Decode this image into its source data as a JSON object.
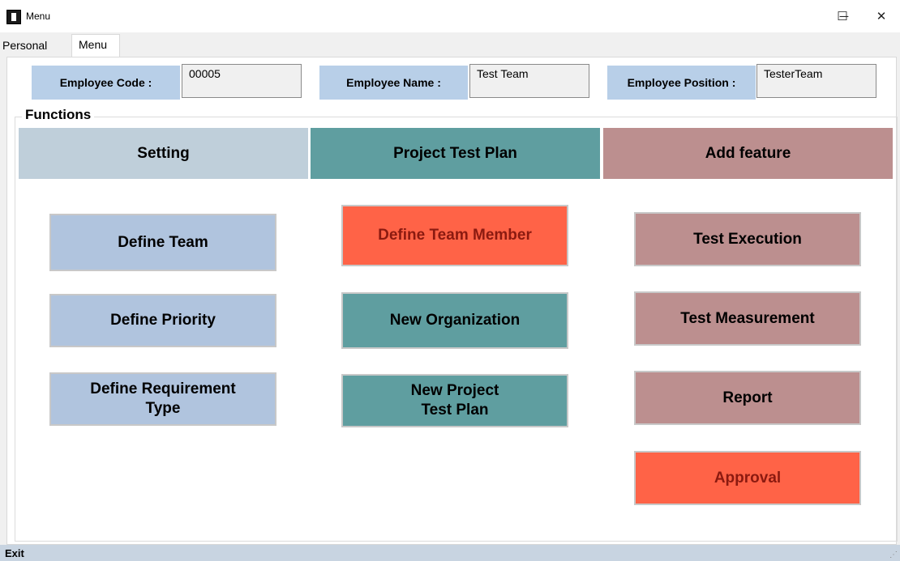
{
  "window": {
    "title": "Menu",
    "minimize": "─",
    "maximize": "☐",
    "close": "✕"
  },
  "tabs": [
    "Personal",
    "Menu"
  ],
  "employee": {
    "code_label": "Employee Code :",
    "code_value": "00005",
    "name_label": "Employee Name :",
    "name_value": "Test Team",
    "position_label": "Employee Position :",
    "position_value": "TesterTeam"
  },
  "functions": {
    "title": "Functions",
    "sections": [
      {
        "header": "Setting",
        "buttons": [
          "Define Team",
          "Define Priority",
          "Define Requirement\nType"
        ]
      },
      {
        "header": "Project Test Plan",
        "buttons": [
          "Define Team Member",
          "New Organization",
          "New Project\nTest Plan"
        ]
      },
      {
        "header": "Add feature",
        "buttons": [
          "Test Execution",
          "Test Measurement",
          "Report",
          "Approval"
        ]
      }
    ]
  },
  "statusbar": {
    "exit": "Exit"
  },
  "colors": {
    "setting": "#b0c4de",
    "project": "#5f9ea0",
    "feature": "#bc8f8f",
    "highlight": "#ff6347",
    "label": "#b8cfe8"
  }
}
